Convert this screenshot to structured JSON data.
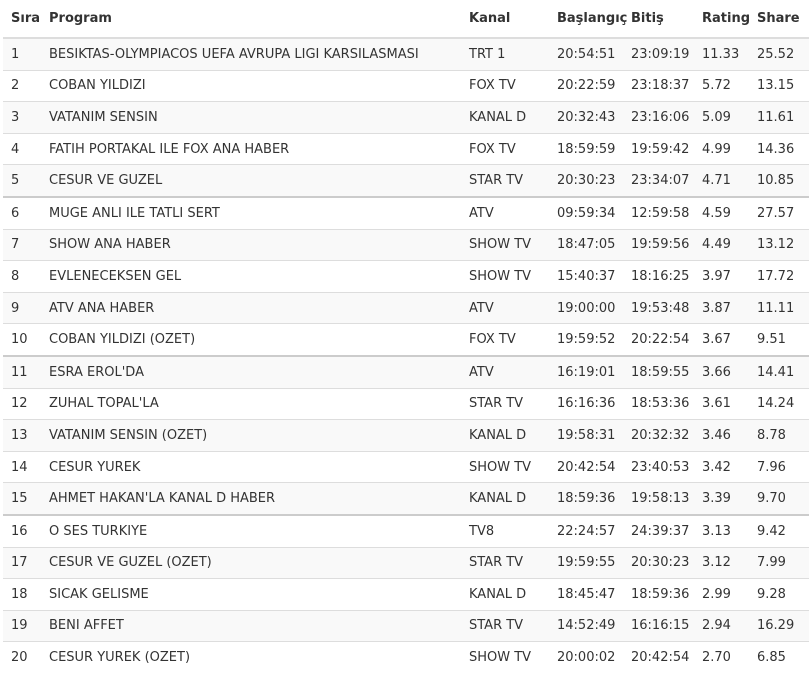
{
  "table": {
    "headers": {
      "rank": "Sıra",
      "program": "Program",
      "channel": "Kanal",
      "start": "Başlangıç",
      "end": "Bitiş",
      "rating": "Rating",
      "share": "Share"
    },
    "rows": [
      {
        "rank": "1",
        "program": "BESIKTAS-OLYMPIACOS UEFA AVRUPA LIGI KARSILASMASI",
        "channel": "TRT 1",
        "start": "20:54:51",
        "end": "23:09:19",
        "rating": "11.33",
        "share": "25.52"
      },
      {
        "rank": "2",
        "program": "COBAN YILDIZI",
        "channel": "FOX TV",
        "start": "20:22:59",
        "end": "23:18:37",
        "rating": "5.72",
        "share": "13.15"
      },
      {
        "rank": "3",
        "program": "VATANIM SENSIN",
        "channel": "KANAL D",
        "start": "20:32:43",
        "end": "23:16:06",
        "rating": "5.09",
        "share": "11.61"
      },
      {
        "rank": "4",
        "program": "FATIH PORTAKAL ILE FOX ANA HABER",
        "channel": "FOX TV",
        "start": "18:59:59",
        "end": "19:59:42",
        "rating": "4.99",
        "share": "14.36"
      },
      {
        "rank": "5",
        "program": "CESUR VE GUZEL",
        "channel": "STAR TV",
        "start": "20:30:23",
        "end": "23:34:07",
        "rating": "4.71",
        "share": "10.85"
      },
      {
        "rank": "6",
        "program": "MUGE ANLI ILE TATLI SERT",
        "channel": "ATV",
        "start": "09:59:34",
        "end": "12:59:58",
        "rating": "4.59",
        "share": "27.57"
      },
      {
        "rank": "7",
        "program": "SHOW ANA HABER",
        "channel": "SHOW TV",
        "start": "18:47:05",
        "end": "19:59:56",
        "rating": "4.49",
        "share": "13.12"
      },
      {
        "rank": "8",
        "program": "EVLENECEKSEN GEL",
        "channel": "SHOW TV",
        "start": "15:40:37",
        "end": "18:16:25",
        "rating": "3.97",
        "share": "17.72"
      },
      {
        "rank": "9",
        "program": "ATV ANA HABER",
        "channel": "ATV",
        "start": "19:00:00",
        "end": "19:53:48",
        "rating": "3.87",
        "share": "11.11"
      },
      {
        "rank": "10",
        "program": "COBAN YILDIZI (OZET)",
        "channel": "FOX TV",
        "start": "19:59:52",
        "end": "20:22:54",
        "rating": "3.67",
        "share": "9.51"
      },
      {
        "rank": "11",
        "program": "ESRA EROL'DA",
        "channel": "ATV",
        "start": "16:19:01",
        "end": "18:59:55",
        "rating": "3.66",
        "share": "14.41"
      },
      {
        "rank": "12",
        "program": "ZUHAL TOPAL'LA",
        "channel": "STAR TV",
        "start": "16:16:36",
        "end": "18:53:36",
        "rating": "3.61",
        "share": "14.24"
      },
      {
        "rank": "13",
        "program": "VATANIM SENSIN (OZET)",
        "channel": "KANAL D",
        "start": "19:58:31",
        "end": "20:32:32",
        "rating": "3.46",
        "share": "8.78"
      },
      {
        "rank": "14",
        "program": "CESUR YUREK",
        "channel": "SHOW TV",
        "start": "20:42:54",
        "end": "23:40:53",
        "rating": "3.42",
        "share": "7.96"
      },
      {
        "rank": "15",
        "program": "AHMET HAKAN'LA KANAL D HABER",
        "channel": "KANAL D",
        "start": "18:59:36",
        "end": "19:58:13",
        "rating": "3.39",
        "share": "9.70"
      },
      {
        "rank": "16",
        "program": "O SES TURKIYE",
        "channel": "TV8",
        "start": "22:24:57",
        "end": "24:39:37",
        "rating": "3.13",
        "share": "9.42"
      },
      {
        "rank": "17",
        "program": "CESUR VE GUZEL (OZET)",
        "channel": "STAR TV",
        "start": "19:59:55",
        "end": "20:30:23",
        "rating": "3.12",
        "share": "7.99"
      },
      {
        "rank": "18",
        "program": "SICAK GELISME",
        "channel": "KANAL D",
        "start": "18:45:47",
        "end": "18:59:36",
        "rating": "2.99",
        "share": "9.28"
      },
      {
        "rank": "19",
        "program": "BENI AFFET",
        "channel": "STAR TV",
        "start": "14:52:49",
        "end": "16:16:15",
        "rating": "2.94",
        "share": "16.29"
      },
      {
        "rank": "20",
        "program": "CESUR YUREK (OZET)",
        "channel": "SHOW TV",
        "start": "20:00:02",
        "end": "20:42:54",
        "rating": "2.70",
        "share": "6.85"
      }
    ]
  }
}
